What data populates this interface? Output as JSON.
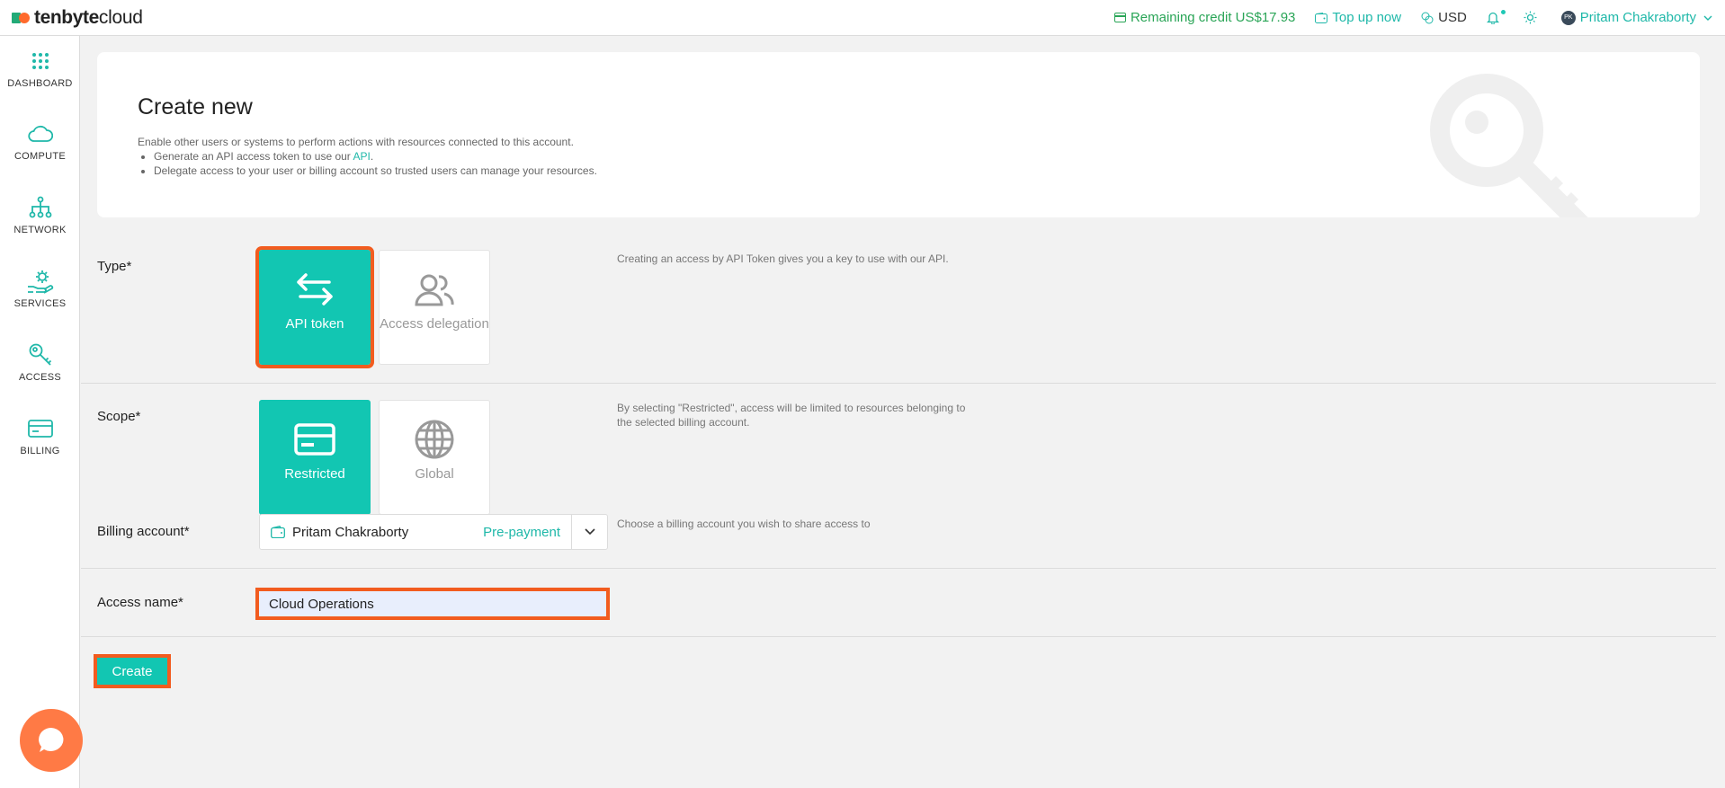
{
  "brand": {
    "part1": "tenbyte",
    "part2": "cloud"
  },
  "topbar": {
    "credit": "Remaining credit US$17.93",
    "topup": "Top up now",
    "currency": "USD",
    "user_initials": "PK",
    "user_name": "Pritam Chakraborty"
  },
  "sidebar": {
    "items": [
      {
        "label": "DASHBOARD",
        "icon": "grid-icon"
      },
      {
        "label": "COMPUTE",
        "icon": "cloud-icon"
      },
      {
        "label": "NETWORK",
        "icon": "network-icon"
      },
      {
        "label": "SERVICES",
        "icon": "services-icon"
      },
      {
        "label": "ACCESS",
        "icon": "key-icon"
      },
      {
        "label": "BILLING",
        "icon": "card-icon"
      }
    ]
  },
  "hero": {
    "title": "Create new",
    "intro": "Enable other users or systems to perform actions with resources connected to this account.",
    "bullet1_prefix": "Generate an API access token to use our ",
    "bullet1_link": "API",
    "bullet1_suffix": ".",
    "bullet2": "Delegate access to your user or billing account so trusted users can manage your resources."
  },
  "form": {
    "type": {
      "label": "Type*",
      "hint": "Creating an access by API Token gives you a key to use with our API.",
      "options": [
        {
          "label": "API token",
          "selected": true
        },
        {
          "label": "Access delegation",
          "selected": false
        }
      ]
    },
    "scope": {
      "label": "Scope*",
      "hint": "By selecting \"Restricted\", access will be limited to resources belonging to the selected billing account.",
      "options": [
        {
          "label": "Restricted",
          "selected": true
        },
        {
          "label": "Global",
          "selected": false
        }
      ]
    },
    "billing": {
      "label": "Billing account*",
      "hint": "Choose a billing account you wish to share access to",
      "account_name": "Pritam Chakraborty",
      "account_type": "Pre-payment"
    },
    "access_name": {
      "label": "Access name*",
      "value": "Cloud Operations"
    },
    "create_label": "Create"
  },
  "colors": {
    "accent": "#12c6b2",
    "highlight": "#f25c1f",
    "credit": "#2aa557",
    "chat": "#ff7a45"
  }
}
